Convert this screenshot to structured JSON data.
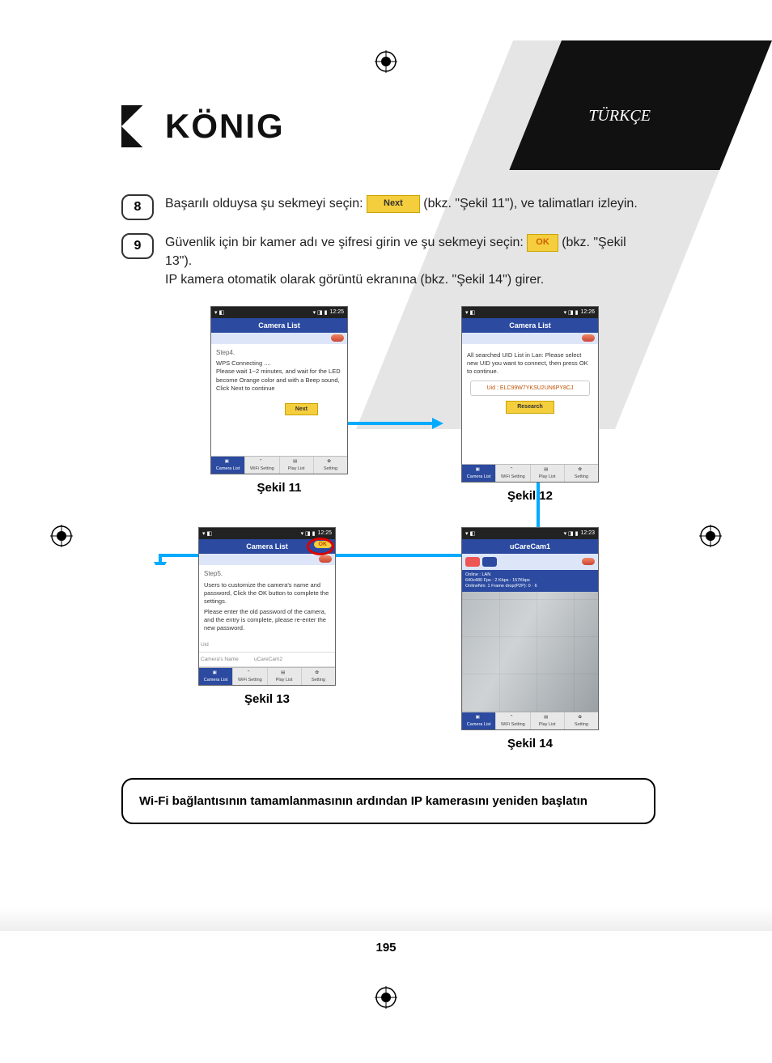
{
  "language_label": "TÜRKÇE",
  "logo_text": "KÖNIG",
  "page_number": "195",
  "steps": {
    "s8": {
      "num": "8",
      "text_a": "Başarılı olduysa şu sekmeyi seçin: ",
      "btn": "Next",
      "text_b": " (bkz. \"Şekil 11\"), ve talimatları izleyin."
    },
    "s9": {
      "num": "9",
      "line1_a": "Güvenlik için bir kamer adı ve şifresi girin ve şu sekmeyi seçin: ",
      "ok": "OK",
      "line1_b": " (bkz. \"Şekil 13\").",
      "line2": "IP kamera otomatik olarak görüntü ekranına (bkz. \"Şekil 14\") girer."
    }
  },
  "status_time_a": "12:25",
  "status_time_b": "12:26",
  "status_time_c": "12:23",
  "bottom_tabs": {
    "camera": "Camera List",
    "wifi": "WiFi Setting",
    "play": "Play List",
    "setting": "Setting"
  },
  "fig11": {
    "title": "Camera List",
    "step": "Step4.",
    "body": "WPS Connecting ....\nPlease wait 1~2 minutes, and wait for the LED become Orange color and with a Beep sound, Click Next to continue",
    "next": "Next",
    "caption": "Şekil 11"
  },
  "fig12": {
    "title": "Camera List",
    "body": "All searched UID List in Lan: Please select new UID you want to connect, then press OK to continue.",
    "uid": "Uid : ELC99W7YKSU2UN6PY8CJ",
    "research": "Research",
    "caption": "Şekil 12"
  },
  "fig13": {
    "title": "Camera List",
    "ok": "OK",
    "step": "Step5.",
    "p1": "Users to customize the camera's name and password, Click the OK button to complete the settings.",
    "p2": "Please enter the old password of the camera, and the entry is complete, please re-enter the new password.",
    "uid_label": "Uid",
    "uid_value": "",
    "name_label": "Camera's Name",
    "name_value": "uCareCam2",
    "caption": "Şekil 13"
  },
  "fig14": {
    "title": "uCareCam1",
    "info1": "Online : LAN",
    "info2": "640x480  Fps : 2  Kbps : 157Kbps",
    "info3": "OnlineNm: 1  Frame drop(P2P): 0 · 6",
    "timestamp": "",
    "caption": "Şekil 14"
  },
  "note": "Wi-Fi bağlantısının tamamlanmasının ardından IP kamerasını yeniden başlatın"
}
